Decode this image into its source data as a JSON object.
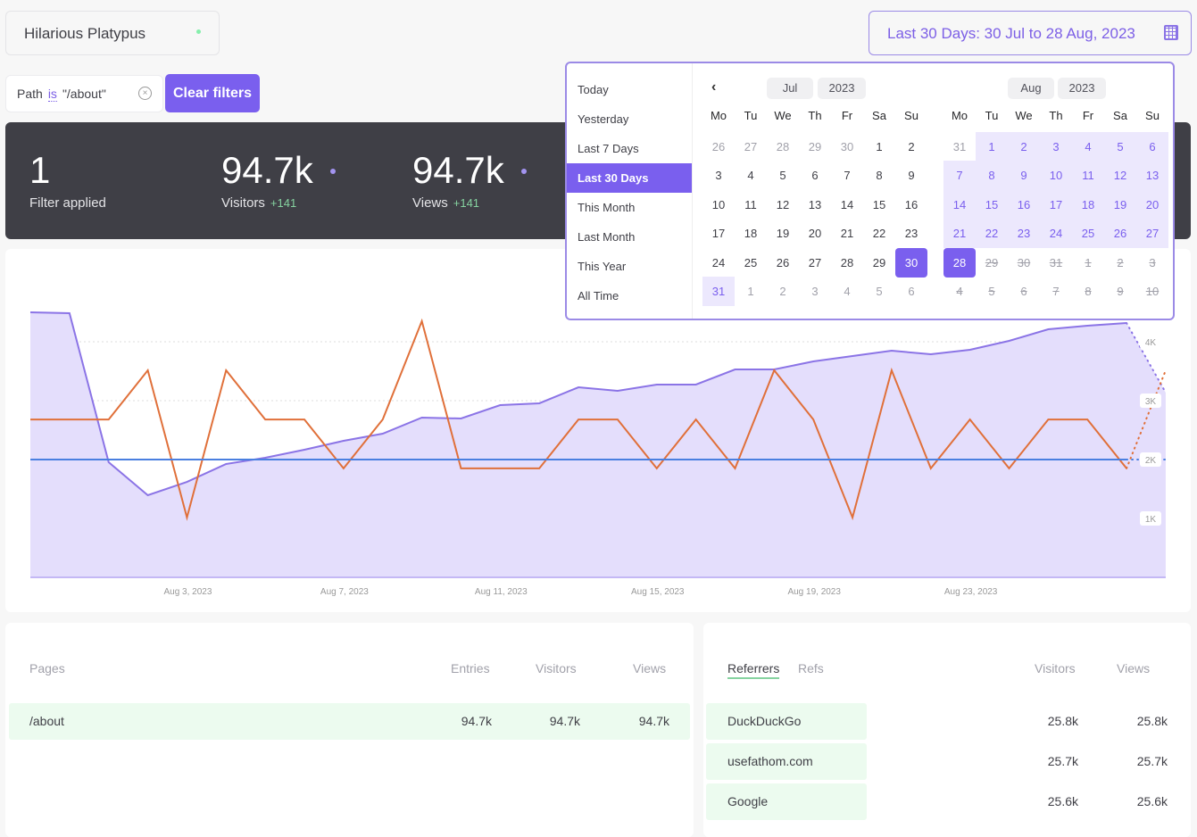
{
  "site": {
    "name": "Hilarious Platypus",
    "status_color": "#86efac"
  },
  "date_range": {
    "label": "Last 30 Days: 30 Jul to 28 Aug, 2023",
    "icon": "calendar-icon"
  },
  "filter": {
    "field": "Path",
    "operator": "is",
    "value": "\"/about\"",
    "clear_label": "Clear filters"
  },
  "stats": [
    {
      "value": "1",
      "label": "Filter applied"
    },
    {
      "value": "94.7k",
      "label": "Visitors",
      "delta": "+141"
    },
    {
      "value": "94.7k",
      "label": "Views",
      "delta": "+141"
    }
  ],
  "date_picker": {
    "presets": [
      "Today",
      "Yesterday",
      "Last 7 Days",
      "Last 30 Days",
      "This Month",
      "Last Month",
      "This Year",
      "All Time"
    ],
    "active_preset": "Last 30 Days",
    "weekdays": [
      "Mo",
      "Tu",
      "We",
      "Th",
      "Fr",
      "Sa",
      "Su"
    ],
    "months": [
      {
        "month": "Jul",
        "year": "2023",
        "weeks": [
          [
            {
              "d": 26,
              "s": "muted"
            },
            {
              "d": 27,
              "s": "muted"
            },
            {
              "d": 28,
              "s": "muted"
            },
            {
              "d": 29,
              "s": "muted"
            },
            {
              "d": 30,
              "s": "muted"
            },
            {
              "d": 1,
              "s": "normal"
            },
            {
              "d": 2,
              "s": "normal"
            }
          ],
          [
            {
              "d": 3,
              "s": "normal"
            },
            {
              "d": 4,
              "s": "normal"
            },
            {
              "d": 5,
              "s": "normal"
            },
            {
              "d": 6,
              "s": "normal"
            },
            {
              "d": 7,
              "s": "normal"
            },
            {
              "d": 8,
              "s": "normal"
            },
            {
              "d": 9,
              "s": "normal"
            }
          ],
          [
            {
              "d": 10,
              "s": "normal"
            },
            {
              "d": 11,
              "s": "normal"
            },
            {
              "d": 12,
              "s": "normal"
            },
            {
              "d": 13,
              "s": "normal"
            },
            {
              "d": 14,
              "s": "normal"
            },
            {
              "d": 15,
              "s": "normal"
            },
            {
              "d": 16,
              "s": "normal"
            }
          ],
          [
            {
              "d": 17,
              "s": "normal"
            },
            {
              "d": 18,
              "s": "normal"
            },
            {
              "d": 19,
              "s": "normal"
            },
            {
              "d": 20,
              "s": "normal"
            },
            {
              "d": 21,
              "s": "normal"
            },
            {
              "d": 22,
              "s": "normal"
            },
            {
              "d": 23,
              "s": "normal"
            }
          ],
          [
            {
              "d": 24,
              "s": "normal"
            },
            {
              "d": 25,
              "s": "normal"
            },
            {
              "d": 26,
              "s": "normal"
            },
            {
              "d": 27,
              "s": "normal"
            },
            {
              "d": 28,
              "s": "normal"
            },
            {
              "d": 29,
              "s": "normal"
            },
            {
              "d": 30,
              "s": "selected"
            }
          ],
          [
            {
              "d": 31,
              "s": "range"
            },
            {
              "d": 1,
              "s": "muted"
            },
            {
              "d": 2,
              "s": "muted"
            },
            {
              "d": 3,
              "s": "muted"
            },
            {
              "d": 4,
              "s": "muted"
            },
            {
              "d": 5,
              "s": "muted"
            },
            {
              "d": 6,
              "s": "muted"
            }
          ]
        ]
      },
      {
        "month": "Aug",
        "year": "2023",
        "weeks": [
          [
            {
              "d": 31,
              "s": "muted"
            },
            {
              "d": 1,
              "s": "range"
            },
            {
              "d": 2,
              "s": "range"
            },
            {
              "d": 3,
              "s": "range"
            },
            {
              "d": 4,
              "s": "range"
            },
            {
              "d": 5,
              "s": "range"
            },
            {
              "d": 6,
              "s": "range"
            }
          ],
          [
            {
              "d": 7,
              "s": "range"
            },
            {
              "d": 8,
              "s": "range"
            },
            {
              "d": 9,
              "s": "range"
            },
            {
              "d": 10,
              "s": "range"
            },
            {
              "d": 11,
              "s": "range"
            },
            {
              "d": 12,
              "s": "range"
            },
            {
              "d": 13,
              "s": "range"
            }
          ],
          [
            {
              "d": 14,
              "s": "range"
            },
            {
              "d": 15,
              "s": "range"
            },
            {
              "d": 16,
              "s": "range"
            },
            {
              "d": 17,
              "s": "range"
            },
            {
              "d": 18,
              "s": "range"
            },
            {
              "d": 19,
              "s": "range"
            },
            {
              "d": 20,
              "s": "range"
            }
          ],
          [
            {
              "d": 21,
              "s": "range"
            },
            {
              "d": 22,
              "s": "range"
            },
            {
              "d": 23,
              "s": "range"
            },
            {
              "d": 24,
              "s": "range"
            },
            {
              "d": 25,
              "s": "range"
            },
            {
              "d": 26,
              "s": "range"
            },
            {
              "d": 27,
              "s": "range"
            }
          ],
          [
            {
              "d": 28,
              "s": "selected"
            },
            {
              "d": 29,
              "s": "disabled"
            },
            {
              "d": 30,
              "s": "disabled"
            },
            {
              "d": 31,
              "s": "disabled"
            },
            {
              "d": 1,
              "s": "disabled"
            },
            {
              "d": 2,
              "s": "disabled"
            },
            {
              "d": 3,
              "s": "disabled"
            }
          ],
          [
            {
              "d": 4,
              "s": "disabled"
            },
            {
              "d": 5,
              "s": "disabled"
            },
            {
              "d": 6,
              "s": "disabled"
            },
            {
              "d": 7,
              "s": "disabled"
            },
            {
              "d": 8,
              "s": "disabled"
            },
            {
              "d": 9,
              "s": "disabled"
            },
            {
              "d": 10,
              "s": "disabled"
            }
          ]
        ]
      }
    ]
  },
  "chart_data": {
    "type": "line",
    "x_tick_labels": [
      "Aug 3, 2023",
      "Aug 7, 2023",
      "Aug 11, 2023",
      "Aug 15, 2023",
      "Aug 19, 2023",
      "Aug 23, 2023"
    ],
    "x_tick_index": [
      4,
      8,
      12,
      16,
      20,
      24
    ],
    "y_tick_labels": [
      "1K",
      "2K",
      "3K",
      "4K"
    ],
    "ylim": [
      0,
      4500
    ],
    "grid": true,
    "series": [
      {
        "type": "area",
        "color": "#8b74e6",
        "fill": "#e4defc",
        "values": [
          4500,
          4485,
          1955,
          1394,
          1621,
          1924,
          2030,
          2167,
          2318,
          2439,
          2712,
          2697,
          2924,
          2955,
          3227,
          3167,
          3273,
          3273,
          3530,
          3530,
          3667,
          3758,
          3848,
          3788,
          3864,
          4015,
          4212,
          4273,
          4318,
          3136
        ]
      },
      {
        "type": "line",
        "color": "#e0703a",
        "values": [
          2680,
          2680,
          2680,
          3515,
          1015,
          3515,
          2680,
          2680,
          1850,
          2680,
          4350,
          1850,
          1850,
          1850,
          2680,
          2680,
          1850,
          2680,
          1850,
          3515,
          2680,
          1015,
          3515,
          1850,
          2680,
          1850,
          2680,
          2680,
          1850,
          3515
        ]
      },
      {
        "type": "line",
        "color": "#4a7fe0",
        "values": [
          2000,
          2000,
          2000,
          2000,
          2000,
          2000,
          2000,
          2000,
          2000,
          2000,
          2000,
          2000,
          2000,
          2000,
          2000,
          2000,
          2000,
          2000,
          2000,
          2000,
          2000,
          2000,
          2000,
          2000,
          2000,
          2000,
          2000,
          2000,
          2000,
          2000
        ]
      }
    ],
    "last_point_partial": true
  },
  "pages": {
    "headers": [
      "Pages",
      "Entries",
      "Visitors",
      "Views"
    ],
    "rows": [
      {
        "page": "/about",
        "entries": "94.7k",
        "visitors": "94.7k",
        "views": "94.7k"
      }
    ]
  },
  "referrers": {
    "tabs": [
      "Referrers",
      "Refs"
    ],
    "active_tab": "Referrers",
    "headers": [
      "Visitors",
      "Views"
    ],
    "rows": [
      {
        "name": "DuckDuckGo",
        "visitors": "25.8k",
        "views": "25.8k"
      },
      {
        "name": "usefathom.com",
        "visitors": "25.7k",
        "views": "25.7k"
      },
      {
        "name": "Google",
        "visitors": "25.6k",
        "views": "25.6k"
      }
    ]
  }
}
